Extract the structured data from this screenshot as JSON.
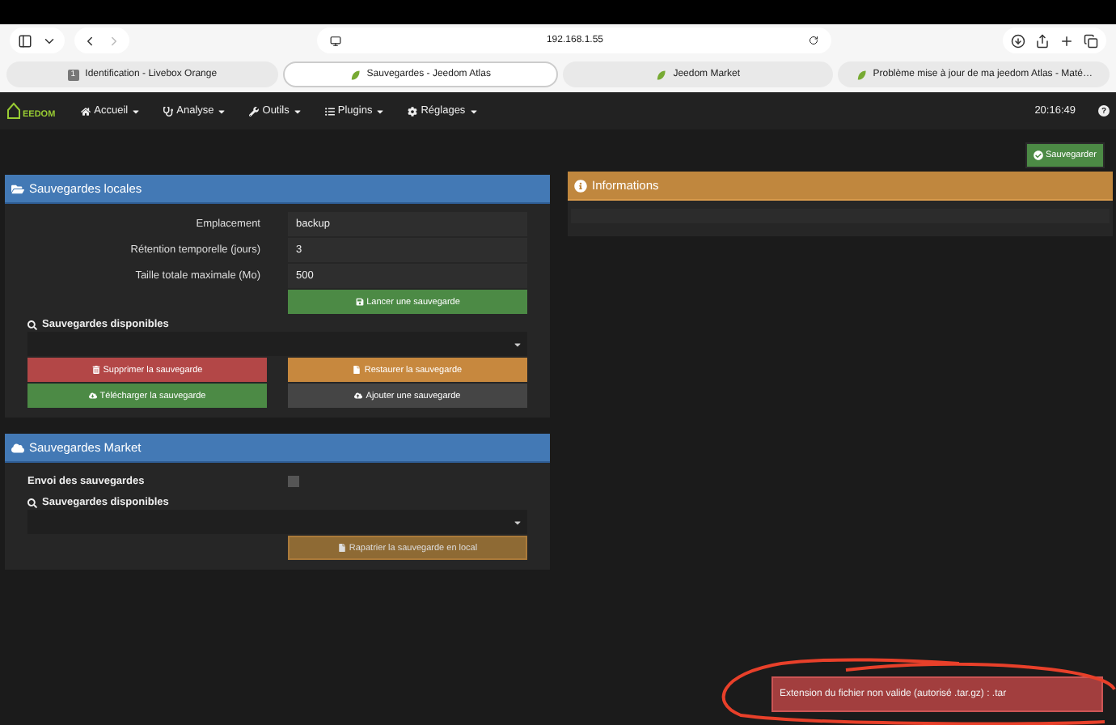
{
  "browser": {
    "url": "192.168.1.55",
    "tabs": [
      {
        "title": "Identification - Livebox Orange",
        "badge": "1",
        "selected": false
      },
      {
        "title": "Sauvegardes - Jeedom Atlas",
        "selected": true
      },
      {
        "title": "Jeedom Market",
        "selected": false
      },
      {
        "title": "Problème mise à jour de ma jeedom Atlas - Maté…",
        "selected": false
      }
    ]
  },
  "nav": {
    "logo": "EEDOM",
    "menus": [
      "Accueil",
      "Analyse",
      "Outils",
      "Plugins",
      "Réglages"
    ],
    "time": "20:16:49",
    "help": "?"
  },
  "save_button": "Sauvegarder",
  "local_panel": {
    "title": "Sauvegardes locales",
    "fields": [
      {
        "label": "Emplacement",
        "value": "backup"
      },
      {
        "label": "Rétention temporelle (jours)",
        "value": "3"
      },
      {
        "label": "Taille totale maximale (Mo)",
        "value": "500"
      }
    ],
    "launch_button": "Lancer une sauvegarde",
    "available_label": "Sauvegardes disponibles",
    "actions": [
      {
        "label": "Supprimer la sauvegarde",
        "kind": "danger"
      },
      {
        "label": "Restaurer la sauvegarde",
        "kind": "warning"
      },
      {
        "label": "Télécharger la sauvegarde",
        "kind": "success"
      },
      {
        "label": "Ajouter une sauvegarde",
        "kind": "default"
      }
    ]
  },
  "info_panel": {
    "title": "Informations"
  },
  "market_panel": {
    "title": "Sauvegardes Market",
    "send_label": "Envoi des sauvegardes",
    "send_checked": false,
    "available_label": "Sauvegardes disponibles",
    "restore_button": "Rapatrier la sauvegarde en local"
  },
  "toast": {
    "message": "Extension du fichier non valide (autorisé .tar.gz) : .tar"
  }
}
